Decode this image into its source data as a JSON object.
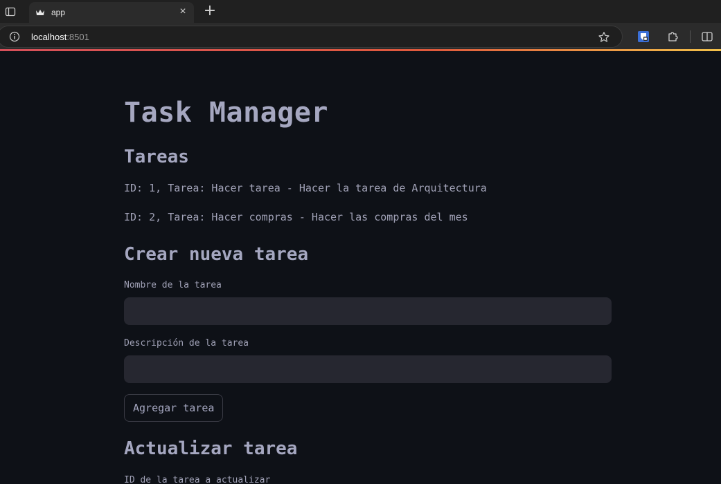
{
  "browser": {
    "tab_title": "app",
    "url_host": "localhost",
    "url_port": ":8501"
  },
  "app": {
    "title": "Task Manager",
    "tasks_heading": "Tareas",
    "tasks": [
      "ID: 1, Tarea: Hacer tarea - Hacer la tarea de Arquitectura",
      "ID: 2, Tarea: Hacer compras - Hacer las compras del mes"
    ],
    "create": {
      "heading": "Crear nueva tarea",
      "name_label": "Nombre de la tarea",
      "name_value": "",
      "description_label": "Descripción de la tarea",
      "description_value": "",
      "button_label": "Agregar tarea"
    },
    "update": {
      "heading": "Actualizar tarea",
      "id_label": "ID de la tarea a actualizar"
    }
  },
  "colors": {
    "background": "#0e1117",
    "text": "#a1a2b7",
    "input_bg": "#262730"
  }
}
